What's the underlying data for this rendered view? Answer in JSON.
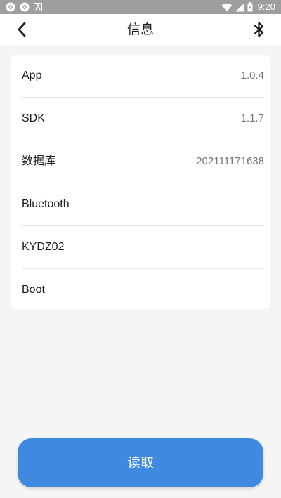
{
  "status_bar": {
    "time": "9:20",
    "icons": [
      "app-icon",
      "app-icon",
      "font-icon",
      "wifi-icon",
      "signal-icon",
      "battery-icon"
    ]
  },
  "header": {
    "title": "信息",
    "back_icon": "chevron-left-icon",
    "bluetooth_icon": "bluetooth-icon"
  },
  "info": {
    "rows": [
      {
        "label": "App",
        "value": "1.0.4"
      },
      {
        "label": "SDK",
        "value": "1.1.7"
      },
      {
        "label": "数据库",
        "value": "202111171638"
      },
      {
        "label": "Bluetooth",
        "value": ""
      },
      {
        "label": "KYDZ02",
        "value": ""
      },
      {
        "label": "Boot",
        "value": ""
      }
    ]
  },
  "actions": {
    "read_label": "读取"
  },
  "colors": {
    "accent": "#3f8ae0",
    "background": "#f5f5f5",
    "status_bar": "#9e9e9e"
  }
}
